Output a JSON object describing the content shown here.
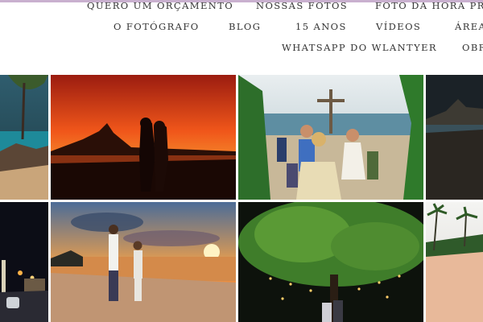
{
  "nav": {
    "row1": [
      "QUERO UM ORÇAMENTO",
      "NOSSAS FOTOS",
      "FOTO DA HORA PRA"
    ],
    "row2": [
      "O FOTÓGRAFO",
      "BLOG",
      "15 ANOS",
      "VÍDEOS",
      "ÁREA"
    ],
    "row3": [
      "WHATSAPP DO WLANTYER",
      "OBR"
    ]
  },
  "gallery": {
    "photos": [
      {
        "subject": "coastal-cliffs-tree"
      },
      {
        "subject": "sunset-couple-silhouette"
      },
      {
        "subject": "beach-wedding-ceremony-cross"
      },
      {
        "subject": "night-rock-seascape"
      },
      {
        "subject": "night-lighthouse-village"
      },
      {
        "subject": "beach-sunset-couple-holding-hands"
      },
      {
        "subject": "night-tree-with-lanterns"
      },
      {
        "subject": "palm-trees-beach"
      }
    ]
  }
}
